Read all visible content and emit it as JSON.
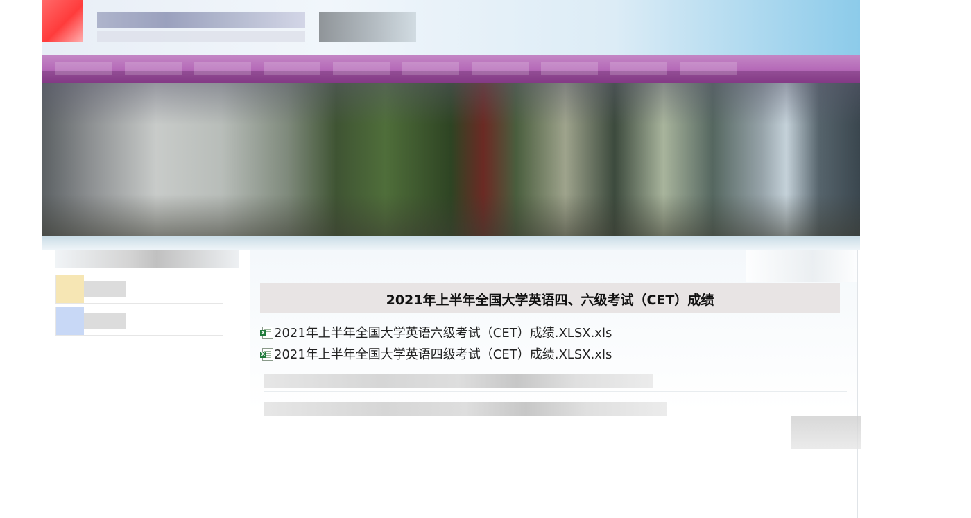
{
  "header": {
    "logo_icon": "school-logo-icon",
    "nav_item_count_visible": 10,
    "colors": {
      "nav_purple": "#b56ab8",
      "nav_dark": "#8e3890",
      "sky_blue": "#8ccbea",
      "title_band": "#e8e4e4"
    }
  },
  "sidebar": {
    "items": [
      {
        "icon": "folder-icon"
      },
      {
        "icon": "document-icon"
      }
    ]
  },
  "main": {
    "title": "2021年上半年全国大学英语四、六级考试（CET）成绩",
    "files": [
      {
        "icon": "excel-file-icon",
        "label": "2021年上半年全国大学英语六级考试（CET）成绩.XLSX.xls"
      },
      {
        "icon": "excel-file-icon",
        "label": "2021年上半年全国大学英语四级考试（CET）成绩.XLSX.xls"
      }
    ]
  }
}
